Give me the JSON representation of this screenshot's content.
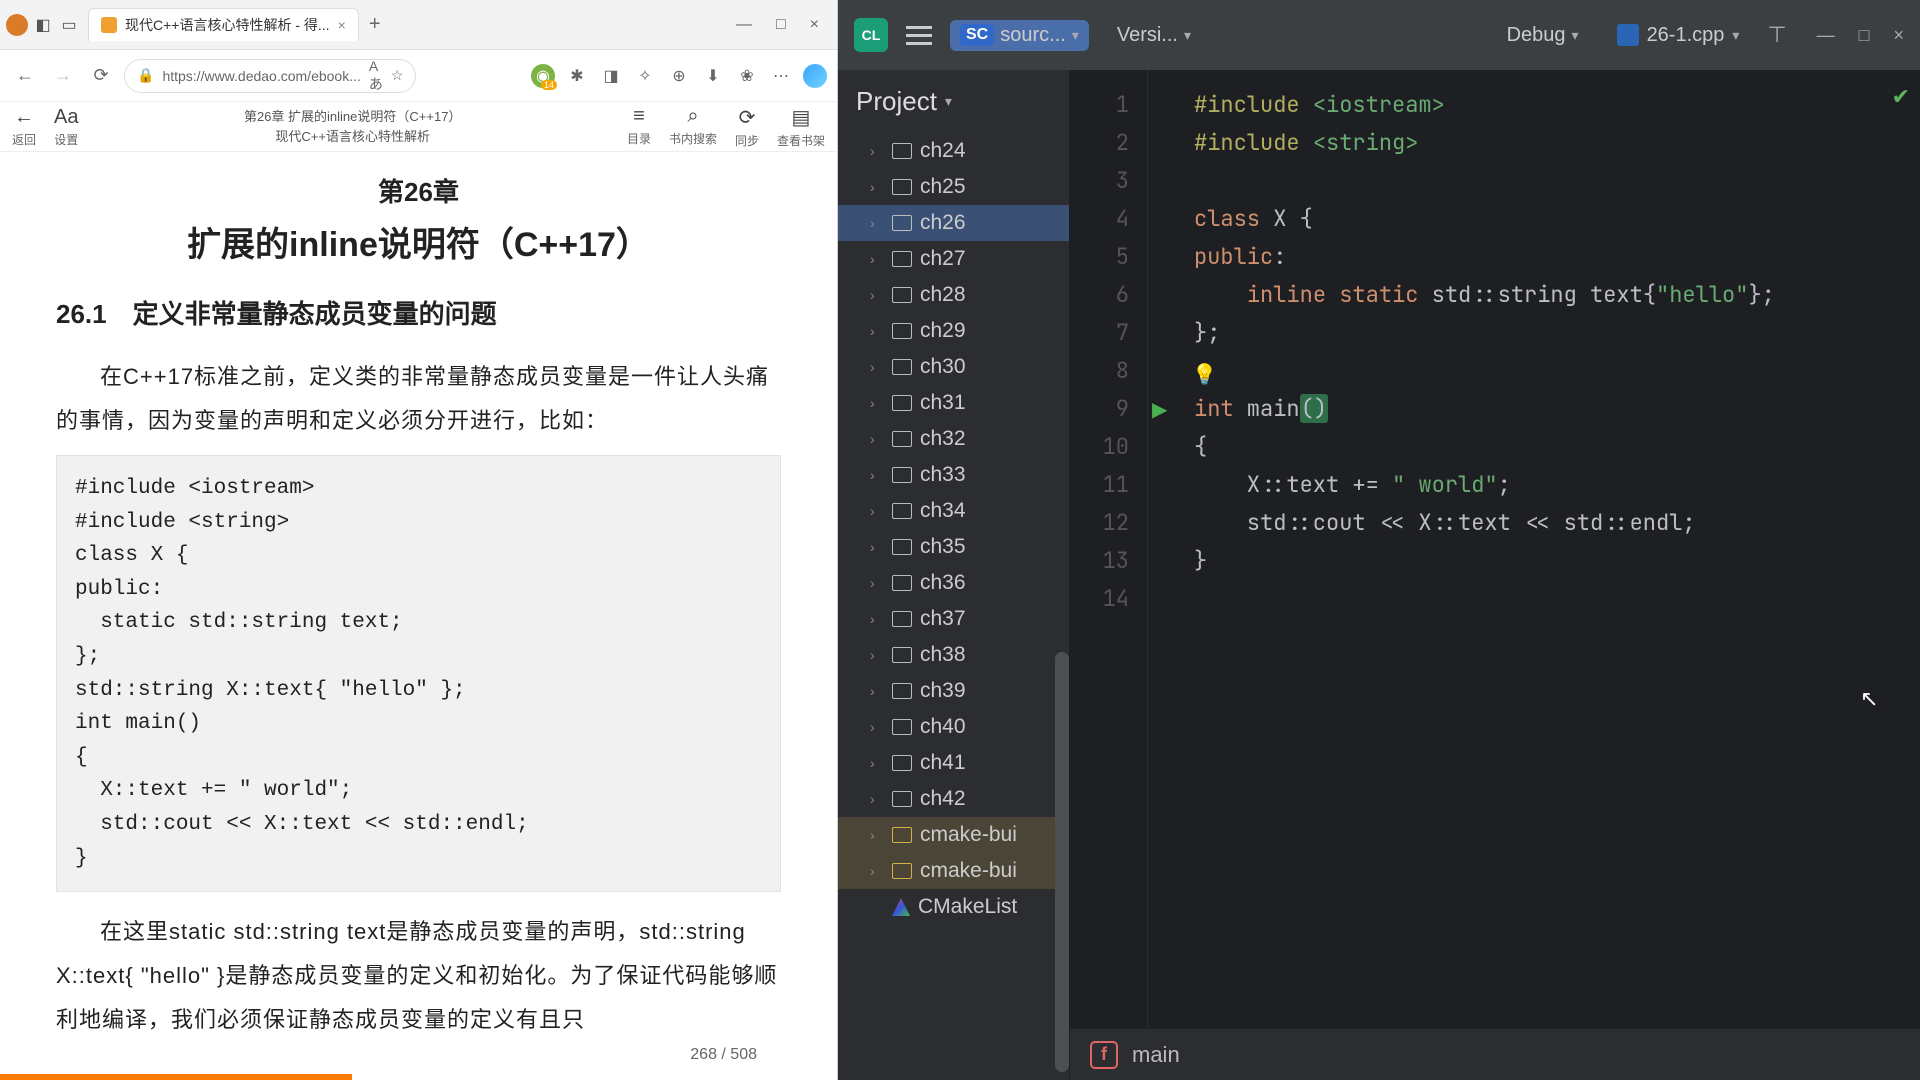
{
  "browser": {
    "tab_title": "现代C++语言核心特性解析 - 得...",
    "url": "https://www.dedao.com/ebook...",
    "url_badge": "Aあ",
    "addr_badge_num": "14",
    "wmin": "—",
    "wmax": "□",
    "wclose": "×",
    "reader_top": {
      "back": "返回",
      "set": "设置",
      "title_top": "第26章 扩展的inline说明符（C++17）",
      "title_sub": "现代C++语言核心特性解析",
      "cat": "目录",
      "search": "书内搜索",
      "sync": "同步",
      "shelf": "查看书架"
    },
    "content": {
      "chapter_no": "第26章",
      "chapter_title": "扩展的inline说明符（C++17）",
      "section": "26.1　定义非常量静态成员变量的问题",
      "para1": "在C++17标准之前，定义类的非常量静态成员变量是一件让人头痛的事情，因为变量的声明和定义必须分开进行，比如：",
      "code": "#include <iostream>\n#include <string>\nclass X {\npublic:\n  static std::string text;\n};\nstd::string X::text{ \"hello\" };\nint main()\n{\n  X::text += \" world\";\n  std::cout << X::text << std::endl;\n}",
      "para2_a": "在这里static std::string text是静态成员变量的声明，std::string X::text{ \"hello\" }是静态成员变量的定义和初始化。为了保证代码能够顺利地编译，我们必须保证静态成员变量的定义有且只",
      "page": "268 / 508",
      "progress_pct": 42
    }
  },
  "ide": {
    "toolbar": {
      "sc_label": "SC",
      "sc_text": "sourc...",
      "ver": "Versi...",
      "debug": "Debug",
      "file": "26-1.cpp"
    },
    "project": {
      "title": "Project",
      "folders": [
        "ch24",
        "ch25",
        "ch26",
        "ch27",
        "ch28",
        "ch29",
        "ch30",
        "ch31",
        "ch32",
        "ch33",
        "ch34",
        "ch35",
        "ch36",
        "ch37",
        "ch38",
        "ch39",
        "ch40",
        "ch41",
        "ch42"
      ],
      "selected": "ch26",
      "modified": [
        "cmake-bui",
        "cmake-bui"
      ],
      "cmake": "CMakeList"
    },
    "code_lines": [
      "1",
      "2",
      "3",
      "4",
      "5",
      "6",
      "7",
      "8",
      "9",
      "10",
      "11",
      "12",
      "13",
      "14"
    ],
    "crumb": "main"
  }
}
